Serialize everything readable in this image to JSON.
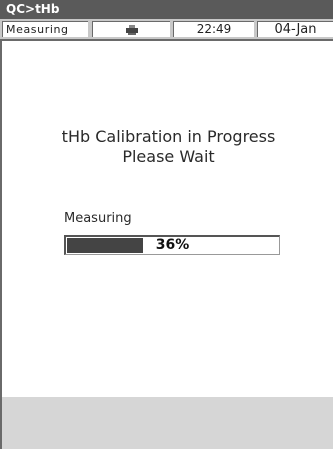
{
  "title_bar": {
    "title": "QC>tHb"
  },
  "status_bar": {
    "mode": "Measuring",
    "icon": "printer-icon",
    "time": "22:49",
    "date": "04-Jan"
  },
  "message": {
    "line1": "tHb Calibration in Progress",
    "line2": "Please Wait"
  },
  "progress": {
    "label": "Measuring",
    "percent_text": "36%",
    "fraction": 0.36
  },
  "colors": {
    "title_bg": "#5a5a5a",
    "status_bg": "#c8c8c8",
    "progress_fill": "#444444",
    "footer_bg": "#d6d6d6"
  }
}
